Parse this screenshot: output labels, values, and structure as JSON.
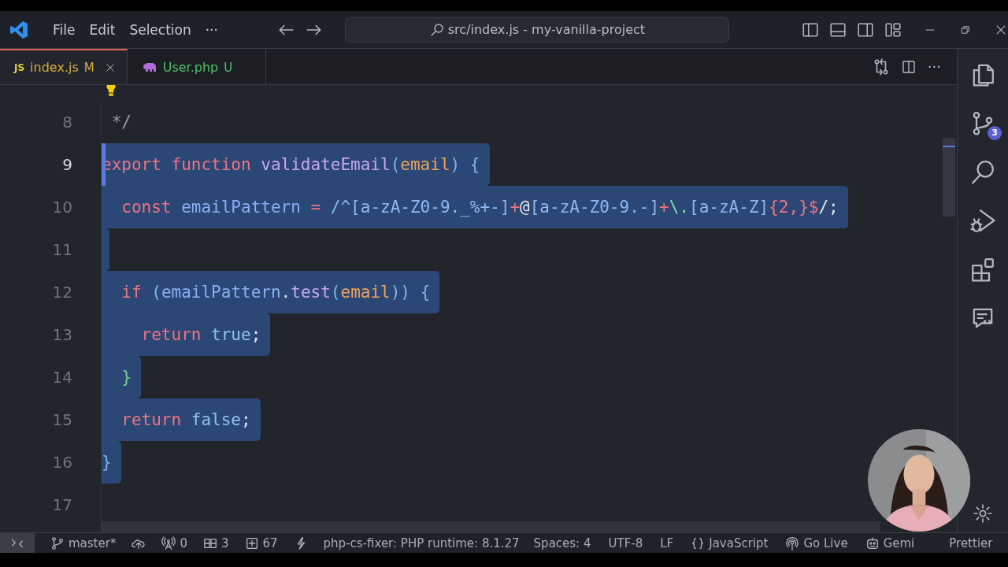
{
  "title_bar": {
    "menu": [
      "File",
      "Edit",
      "Selection",
      "···"
    ],
    "command_center": "src/index.js - my-vanilla-project"
  },
  "tabs": [
    {
      "kind": "js",
      "icon_text": "JS",
      "label": "index.js",
      "status": "M",
      "color": "#d7ad3f",
      "selected": true
    },
    {
      "kind": "php",
      "label": "User.php",
      "status": "U",
      "color": "#4fc36a",
      "selected": false
    }
  ],
  "tab_actions": {
    "more": "···"
  },
  "editor": {
    "lines": [
      {
        "number": "8",
        "current": false,
        "selected": false,
        "lightbulb": true,
        "tokens": [
          {
            "text": " */",
            "kind": "comment"
          }
        ]
      },
      {
        "number": "9",
        "current": true,
        "selected": true,
        "tokens": [
          {
            "text": "export",
            "kind": "kw"
          },
          {
            "text": " function",
            "kind": "kw"
          },
          {
            "text": " validateEmail",
            "kind": "fn"
          },
          {
            "text": "(",
            "kind": "punc"
          },
          {
            "text": "email",
            "kind": "param"
          },
          {
            "text": ")",
            "kind": "punc"
          },
          {
            "text": " {",
            "kind": "punc"
          }
        ]
      },
      {
        "number": "10",
        "current": false,
        "selected": true,
        "tokens": [
          {
            "text": "  const",
            "kind": "kw"
          },
          {
            "text": " emailPattern",
            "kind": "var"
          },
          {
            "text": " = ",
            "kind": "op"
          },
          {
            "text": "/^[a-zA-Z0-9._%+-]",
            "kind": "re"
          },
          {
            "text": "+",
            "kind": "op"
          },
          {
            "text": "@",
            "kind": "plain"
          },
          {
            "text": "[a-zA-Z0-9.-]",
            "kind": "re"
          },
          {
            "text": "+",
            "kind": "op"
          },
          {
            "text": "\\.",
            "kind": "esc"
          },
          {
            "text": "[a-zA-Z]",
            "kind": "re"
          },
          {
            "text": "{2,}$",
            "kind": "op"
          },
          {
            "text": "/;",
            "kind": "plain"
          }
        ]
      },
      {
        "number": "11",
        "current": false,
        "selected": true
      },
      {
        "number": "12",
        "current": false,
        "selected": true,
        "tokens": [
          {
            "text": "  if",
            "kind": "kw"
          },
          {
            "text": " (",
            "kind": "punc"
          },
          {
            "text": "emailPattern",
            "kind": "var"
          },
          {
            "text": ".",
            "kind": "plain"
          },
          {
            "text": "test",
            "kind": "fn"
          },
          {
            "text": "(",
            "kind": "punc"
          },
          {
            "text": "email",
            "kind": "param"
          },
          {
            "text": "))",
            "kind": "punc"
          },
          {
            "text": " {",
            "kind": "punc"
          }
        ]
      },
      {
        "number": "13",
        "current": false,
        "selected": true,
        "tokens": [
          {
            "text": "    return",
            "kind": "kw"
          },
          {
            "text": " true",
            "kind": "bool"
          },
          {
            "text": ";",
            "kind": "plain"
          }
        ]
      },
      {
        "number": "14",
        "current": false,
        "selected": true,
        "tokens": [
          {
            "text": "  }",
            "kind": "brace2"
          }
        ]
      },
      {
        "number": "15",
        "current": false,
        "selected": true,
        "tokens": [
          {
            "text": "  return",
            "kind": "kw"
          },
          {
            "text": " false",
            "kind": "bool"
          },
          {
            "text": ";",
            "kind": "plain"
          }
        ]
      },
      {
        "number": "16",
        "current": false,
        "selected": true,
        "tokens": [
          {
            "text": "}",
            "kind": "punc"
          }
        ]
      },
      {
        "number": "17",
        "current": false,
        "selected": false
      }
    ]
  },
  "activity_bar": [
    {
      "kind": "files"
    },
    {
      "kind": "source-control",
      "badge": "3"
    },
    {
      "kind": "search"
    },
    {
      "kind": "run-debug"
    },
    {
      "kind": "extensions"
    },
    {
      "kind": "chat"
    },
    {
      "kind": "gear"
    }
  ],
  "status_bar": {
    "left": [
      {
        "kind": "remote"
      },
      {
        "kind": "branch",
        "text": "master*"
      },
      {
        "kind": "cloud"
      },
      {
        "kind": "antenna",
        "text": "0"
      },
      {
        "kind": "panels",
        "text": "3"
      },
      {
        "kind": "plus-box",
        "text": "67"
      },
      {
        "kind": "bolt"
      },
      {
        "kind": "text",
        "text": "php-cs-fixer: PHP runtime: 8.1.27"
      }
    ],
    "right": [
      {
        "kind": "text",
        "text": "Spaces: 4"
      },
      {
        "kind": "text",
        "text": "UTF-8"
      },
      {
        "kind": "text",
        "text": "LF"
      },
      {
        "kind": "braces",
        "text": "JavaScript"
      },
      {
        "kind": "broadcast",
        "text": "Go Live"
      },
      {
        "kind": "robot",
        "text": "Gemi"
      },
      {
        "kind": "text",
        "text": "Prettier"
      }
    ]
  }
}
